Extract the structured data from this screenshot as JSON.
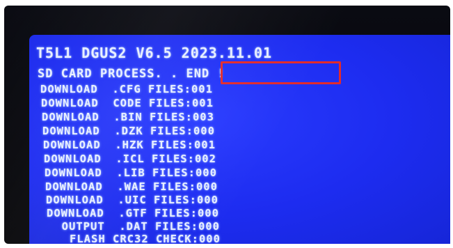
{
  "screen": {
    "header": "T5L1 DGUS2 V6.5 2023.11.01",
    "process_line": "SD CARD PROCESS. . END !",
    "rows": [
      "DOWNLOAD  .CFG FILES:001",
      "DOWNLOAD  CODE FILES:001",
      "DOWNLOAD  .BIN FILES:003",
      "DOWNLOAD  .DZK FILES:000",
      "DOWNLOAD  .HZK FILES:001",
      "DOWNLOAD  .ICL FILES:002",
      "DOWNLOAD  .LIB FILES:000",
      "DOWNLOAD  .WAE FILES:000",
      "DOWNLOAD  .UIC FILES:000",
      "DOWNLOAD  .GTF FILES:000",
      "  OUTPUT  .DAT FILES:000",
      "   FLASH CRC32 CHECK:000"
    ]
  },
  "colors": {
    "screen_background": "#1d2cf0",
    "text": "#e8efff",
    "highlight_box": "#e32b2b"
  }
}
